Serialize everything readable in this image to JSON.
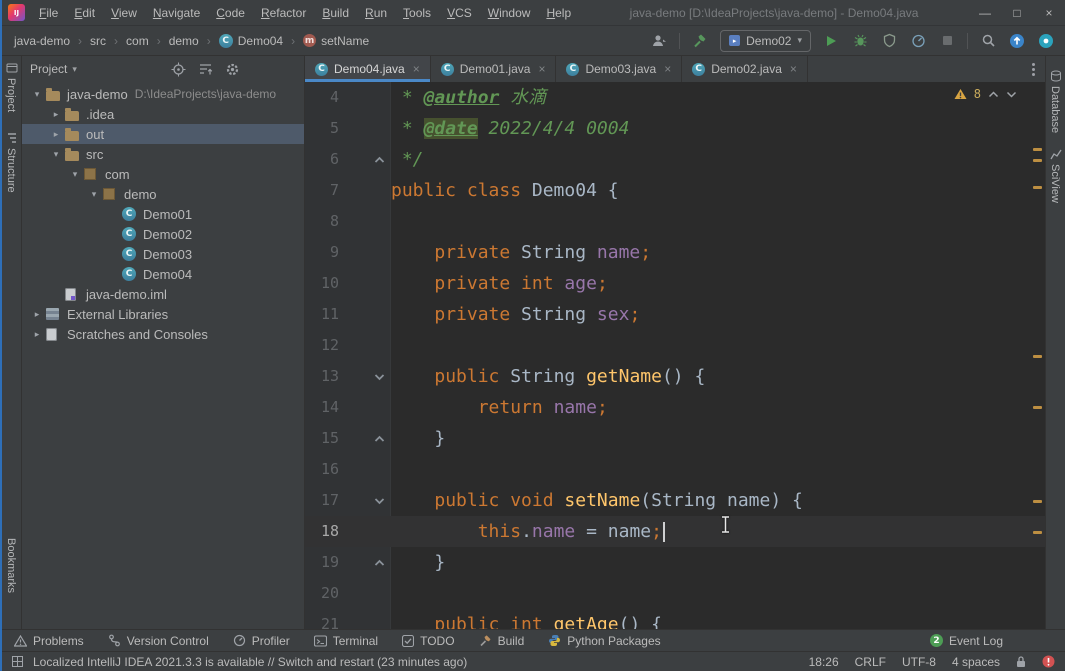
{
  "icons": {
    "chevron_down": "▾",
    "chevron_right": "▸",
    "breadcrumb_sep": "›",
    "close": "×",
    "class_glyph": "C",
    "method_glyph": "m",
    "minimize_glyph": "—",
    "maximize_glyph": "□",
    "close_window_glyph": "×",
    "logo_text": "IJ"
  },
  "title_bar": {
    "menus": [
      "File",
      "Edit",
      "View",
      "Navigate",
      "Code",
      "Refactor",
      "Build",
      "Run",
      "Tools",
      "VCS",
      "Window",
      "Help"
    ],
    "title": "java-demo [D:\\IdeaProjects\\java-demo] - Demo04.java"
  },
  "nav_bar": {
    "breadcrumbs": [
      {
        "label": "java-demo"
      },
      {
        "label": "src"
      },
      {
        "label": "com"
      },
      {
        "label": "demo"
      },
      {
        "label": "Demo04",
        "icon": "class"
      },
      {
        "label": "setName",
        "icon": "method"
      }
    ],
    "run_config": "Demo02"
  },
  "tool_stripes": {
    "left": [
      "Project",
      "Structure",
      "Bookmarks"
    ],
    "right": [
      "Database",
      "SciView"
    ]
  },
  "project_panel": {
    "header": {
      "title": "Project"
    },
    "tree": [
      {
        "label": "java-demo",
        "path": "D:\\IdeaProjects\\java-demo",
        "icon": "folder",
        "chevron": "down",
        "indent": 0
      },
      {
        "label": ".idea",
        "icon": "folder",
        "chevron": "right",
        "indent": 1
      },
      {
        "label": "out",
        "icon": "folder",
        "chevron": "right",
        "indent": 1,
        "selected": true
      },
      {
        "label": "src",
        "icon": "folder",
        "chevron": "down",
        "indent": 1
      },
      {
        "label": "com",
        "icon": "package",
        "chevron": "down",
        "indent": 2
      },
      {
        "label": "demo",
        "icon": "package",
        "chevron": "down",
        "indent": 3
      },
      {
        "label": "Demo01",
        "icon": "class",
        "indent": 4
      },
      {
        "label": "Demo02",
        "icon": "class",
        "indent": 4
      },
      {
        "label": "Demo03",
        "icon": "class",
        "indent": 4
      },
      {
        "label": "Demo04",
        "icon": "class",
        "indent": 4
      },
      {
        "label": "java-demo.iml",
        "icon": "module",
        "indent": 1
      },
      {
        "label": "External Libraries",
        "icon": "library",
        "chevron": "right",
        "indent": 0
      },
      {
        "label": "Scratches and Consoles",
        "icon": "scratches",
        "chevron": "right",
        "indent": 0
      }
    ]
  },
  "editor": {
    "tabs": [
      {
        "label": "Demo04.java",
        "active": true
      },
      {
        "label": "Demo01.java",
        "active": false
      },
      {
        "label": "Demo03.java",
        "active": false
      },
      {
        "label": "Demo02.java",
        "active": false
      }
    ],
    "warnings": {
      "count": "8"
    },
    "stripe_marks": [
      66,
      77,
      104,
      273,
      324,
      418,
      449
    ],
    "lines": [
      {
        "num": 4,
        "tokens": [
          [
            " * ",
            "d"
          ],
          [
            "@author",
            "t"
          ],
          [
            " 水滴",
            "d"
          ]
        ]
      },
      {
        "num": 5,
        "tokens": [
          [
            " * ",
            "d"
          ],
          [
            "@date",
            "th"
          ],
          [
            " 2022/4/4 0004",
            "d"
          ]
        ]
      },
      {
        "num": 6,
        "fold": "up",
        "tokens": [
          [
            " */",
            "d"
          ]
        ]
      },
      {
        "num": 7,
        "tokens": [
          [
            "public class",
            "k"
          ],
          [
            " Demo04 {",
            "p"
          ]
        ]
      },
      {
        "num": 8,
        "tokens": []
      },
      {
        "num": 9,
        "tokens": [
          [
            "    ",
            "p"
          ],
          [
            "private",
            "k"
          ],
          [
            " String ",
            "p"
          ],
          [
            "name",
            "f"
          ],
          [
            ";",
            "k"
          ]
        ]
      },
      {
        "num": 10,
        "tokens": [
          [
            "    ",
            "p"
          ],
          [
            "private int",
            "k"
          ],
          [
            " ",
            "p"
          ],
          [
            "age",
            "f"
          ],
          [
            ";",
            "k"
          ]
        ]
      },
      {
        "num": 11,
        "tokens": [
          [
            "    ",
            "p"
          ],
          [
            "private",
            "k"
          ],
          [
            " String ",
            "p"
          ],
          [
            "sex",
            "f"
          ],
          [
            ";",
            "k"
          ]
        ]
      },
      {
        "num": 12,
        "tokens": []
      },
      {
        "num": 13,
        "fold": "down",
        "tokens": [
          [
            "    ",
            "p"
          ],
          [
            "public",
            "k"
          ],
          [
            " String ",
            "p"
          ],
          [
            "getName",
            "m"
          ],
          [
            "() {",
            "p"
          ]
        ]
      },
      {
        "num": 14,
        "tokens": [
          [
            "        ",
            "p"
          ],
          [
            "return",
            "k"
          ],
          [
            " ",
            "p"
          ],
          [
            "name",
            "f"
          ],
          [
            ";",
            "k"
          ]
        ]
      },
      {
        "num": 15,
        "fold": "up",
        "tokens": [
          [
            "    }",
            "p"
          ]
        ]
      },
      {
        "num": 16,
        "tokens": []
      },
      {
        "num": 17,
        "fold": "down",
        "tokens": [
          [
            "    ",
            "p"
          ],
          [
            "public void",
            "k"
          ],
          [
            " ",
            "p"
          ],
          [
            "setName",
            "m"
          ],
          [
            "(String name) {",
            "p"
          ]
        ]
      },
      {
        "num": 18,
        "current": true,
        "caret": true,
        "tokens": [
          [
            "        ",
            "p"
          ],
          [
            "this",
            "k"
          ],
          [
            ".",
            "p"
          ],
          [
            "name",
            "f"
          ],
          [
            " = name",
            "p"
          ],
          [
            ";",
            "k"
          ]
        ]
      },
      {
        "num": 19,
        "fold": "up",
        "tokens": [
          [
            "    }",
            "p"
          ]
        ]
      },
      {
        "num": 20,
        "tokens": []
      },
      {
        "num": 21,
        "tokens": [
          [
            "    ",
            "p"
          ],
          [
            "public int",
            "k"
          ],
          [
            " ",
            "p"
          ],
          [
            "getAge",
            "m"
          ],
          [
            "() {",
            "p"
          ]
        ]
      }
    ]
  },
  "bottom_bar": {
    "tools": [
      {
        "label": "Problems",
        "icon": "problems"
      },
      {
        "label": "Version Control",
        "icon": "vcs"
      },
      {
        "label": "Profiler",
        "icon": "profiler"
      },
      {
        "label": "Terminal",
        "icon": "terminal"
      },
      {
        "label": "TODO",
        "icon": "todo"
      },
      {
        "label": "Build",
        "icon": "build"
      },
      {
        "label": "Python Packages",
        "icon": "python"
      }
    ],
    "event_log": {
      "label": "Event Log",
      "badge": "2"
    }
  },
  "status_bar": {
    "message": "Localized IntelliJ IDEA 2021.3.3 is available // Switch and restart (23 minutes ago)",
    "caret": "18:26",
    "line_sep": "CRLF",
    "encoding": "UTF-8",
    "indent": "4 spaces"
  }
}
